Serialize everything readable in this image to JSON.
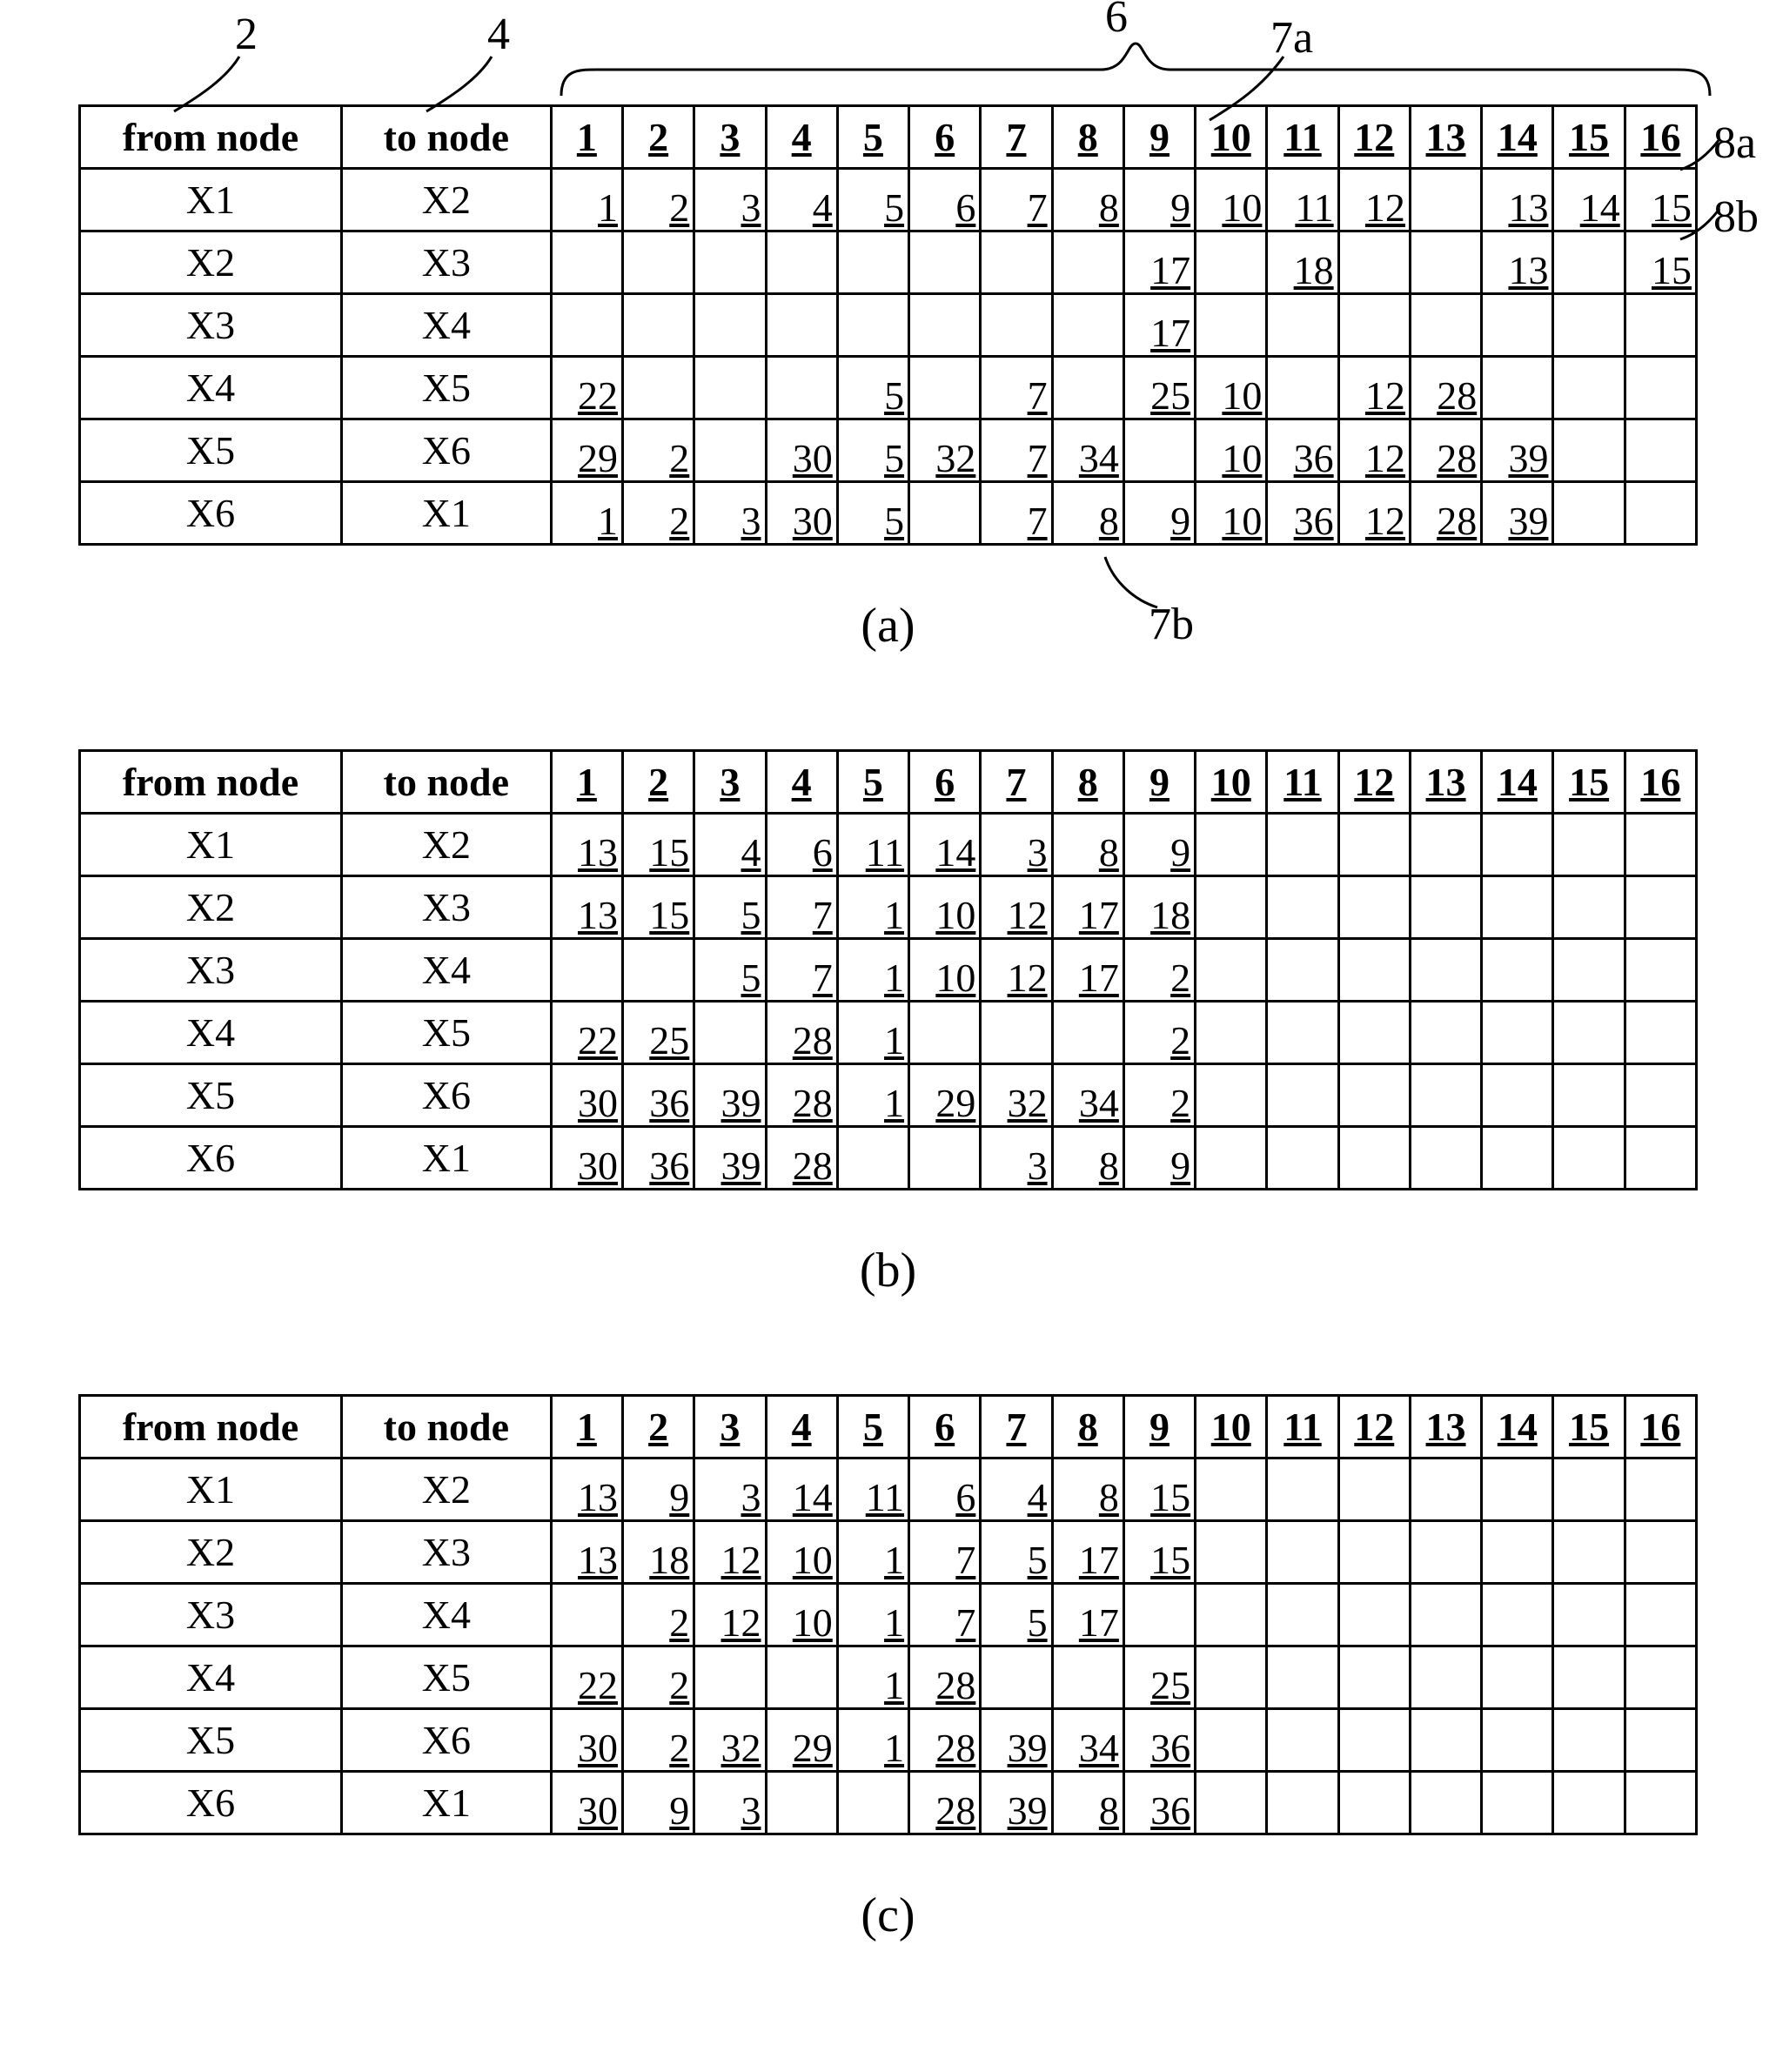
{
  "columns_header": {
    "from": "from node",
    "to": "to node"
  },
  "slot_headers": [
    "1",
    "2",
    "3",
    "4",
    "5",
    "6",
    "7",
    "8",
    "9",
    "10",
    "11",
    "12",
    "13",
    "14",
    "15",
    "16"
  ],
  "annotations": {
    "col_from": "2",
    "col_to": "4",
    "brace_slots": "6",
    "label_7a": "7a",
    "label_7b": "7b",
    "label_8a": "8a",
    "label_8b": "8b"
  },
  "tables": [
    {
      "caption": "(a)",
      "rows": [
        {
          "from": "X1",
          "to": "X2",
          "cells": [
            "1",
            "2",
            "3",
            "4",
            "5",
            "6",
            "7",
            "8",
            "9",
            "10",
            "11",
            "12",
            "",
            "13",
            "14",
            "15"
          ]
        },
        {
          "from": "X2",
          "to": "X3",
          "cells": [
            "",
            "",
            "",
            "",
            "",
            "",
            "",
            "",
            "17",
            "",
            "18",
            "",
            "",
            "13",
            "",
            "15"
          ]
        },
        {
          "from": "X3",
          "to": "X4",
          "cells": [
            "",
            "",
            "",
            "",
            "",
            "",
            "",
            "",
            "17",
            "",
            "",
            "",
            "",
            "",
            "",
            ""
          ]
        },
        {
          "from": "X4",
          "to": "X5",
          "cells": [
            "22",
            "",
            "",
            "",
            "5",
            "",
            "7",
            "",
            "25",
            "10",
            "",
            "12",
            "28",
            "",
            "",
            ""
          ]
        },
        {
          "from": "X5",
          "to": "X6",
          "cells": [
            "29",
            "2",
            "",
            "30",
            "5",
            "32",
            "7",
            "34",
            "",
            "10",
            "36",
            "12",
            "28",
            "39",
            "",
            ""
          ]
        },
        {
          "from": "X6",
          "to": "X1",
          "cells": [
            "1",
            "2",
            "3",
            "30",
            "5",
            "",
            "7",
            "8",
            "9",
            "10",
            "36",
            "12",
            "28",
            "39",
            "",
            ""
          ]
        }
      ]
    },
    {
      "caption": "(b)",
      "rows": [
        {
          "from": "X1",
          "to": "X2",
          "cells": [
            "13",
            "15",
            "4",
            "6",
            "11",
            "14",
            "3",
            "8",
            "9",
            "",
            "",
            "",
            "",
            "",
            "",
            ""
          ]
        },
        {
          "from": "X2",
          "to": "X3",
          "cells": [
            "13",
            "15",
            "5",
            "7",
            "1",
            "10",
            "12",
            "17",
            "18",
            "",
            "",
            "",
            "",
            "",
            "",
            ""
          ]
        },
        {
          "from": "X3",
          "to": "X4",
          "cells": [
            "",
            "",
            "5",
            "7",
            "1",
            "10",
            "12",
            "17",
            "2",
            "",
            "",
            "",
            "",
            "",
            "",
            ""
          ]
        },
        {
          "from": "X4",
          "to": "X5",
          "cells": [
            "22",
            "25",
            "",
            "28",
            "1",
            "",
            "",
            "",
            "2",
            "",
            "",
            "",
            "",
            "",
            "",
            ""
          ]
        },
        {
          "from": "X5",
          "to": "X6",
          "cells": [
            "30",
            "36",
            "39",
            "28",
            "1",
            "29",
            "32",
            "34",
            "2",
            "",
            "",
            "",
            "",
            "",
            "",
            ""
          ]
        },
        {
          "from": "X6",
          "to": "X1",
          "cells": [
            "30",
            "36",
            "39",
            "28",
            "",
            "",
            "3",
            "8",
            "9",
            "",
            "",
            "",
            "",
            "",
            "",
            ""
          ]
        }
      ]
    },
    {
      "caption": "(c)",
      "rows": [
        {
          "from": "X1",
          "to": "X2",
          "cells": [
            "13",
            "9",
            "3",
            "14",
            "11",
            "6",
            "4",
            "8",
            "15",
            "",
            "",
            "",
            "",
            "",
            "",
            ""
          ]
        },
        {
          "from": "X2",
          "to": "X3",
          "cells": [
            "13",
            "18",
            "12",
            "10",
            "1",
            "7",
            "5",
            "17",
            "15",
            "",
            "",
            "",
            "",
            "",
            "",
            ""
          ]
        },
        {
          "from": "X3",
          "to": "X4",
          "cells": [
            "",
            "2",
            "12",
            "10",
            "1",
            "7",
            "5",
            "17",
            "",
            "",
            "",
            "",
            "",
            "",
            "",
            ""
          ]
        },
        {
          "from": "X4",
          "to": "X5",
          "cells": [
            "22",
            "2",
            "",
            "",
            "1",
            "28",
            "",
            "",
            "25",
            "",
            "",
            "",
            "",
            "",
            "",
            ""
          ]
        },
        {
          "from": "X5",
          "to": "X6",
          "cells": [
            "30",
            "2",
            "32",
            "29",
            "1",
            "28",
            "39",
            "34",
            "36",
            "",
            "",
            "",
            "",
            "",
            "",
            ""
          ]
        },
        {
          "from": "X6",
          "to": "X1",
          "cells": [
            "30",
            "9",
            "3",
            "",
            "",
            "28",
            "39",
            "8",
            "36",
            "",
            "",
            "",
            "",
            "",
            "",
            ""
          ]
        }
      ]
    }
  ],
  "chart_data": [
    {
      "type": "table",
      "title": "(a)",
      "columns": [
        "from node",
        "to node",
        "1",
        "2",
        "3",
        "4",
        "5",
        "6",
        "7",
        "8",
        "9",
        "10",
        "11",
        "12",
        "13",
        "14",
        "15",
        "16"
      ],
      "rows": [
        [
          "X1",
          "X2",
          1,
          2,
          3,
          4,
          5,
          6,
          7,
          8,
          9,
          10,
          11,
          12,
          null,
          13,
          14,
          15
        ],
        [
          "X2",
          "X3",
          null,
          null,
          null,
          null,
          null,
          null,
          null,
          null,
          17,
          null,
          18,
          null,
          null,
          13,
          null,
          15
        ],
        [
          "X3",
          "X4",
          null,
          null,
          null,
          null,
          null,
          null,
          null,
          null,
          17,
          null,
          null,
          null,
          null,
          null,
          null,
          null
        ],
        [
          "X4",
          "X5",
          22,
          null,
          null,
          null,
          5,
          null,
          7,
          null,
          25,
          10,
          null,
          12,
          28,
          null,
          null,
          null
        ],
        [
          "X5",
          "X6",
          29,
          2,
          null,
          30,
          5,
          32,
          7,
          34,
          null,
          10,
          36,
          12,
          28,
          39,
          null,
          null
        ],
        [
          "X6",
          "X1",
          1,
          2,
          3,
          30,
          5,
          null,
          7,
          8,
          9,
          10,
          36,
          12,
          28,
          39,
          null,
          null
        ]
      ]
    },
    {
      "type": "table",
      "title": "(b)",
      "columns": [
        "from node",
        "to node",
        "1",
        "2",
        "3",
        "4",
        "5",
        "6",
        "7",
        "8",
        "9",
        "10",
        "11",
        "12",
        "13",
        "14",
        "15",
        "16"
      ],
      "rows": [
        [
          "X1",
          "X2",
          13,
          15,
          4,
          6,
          11,
          14,
          3,
          8,
          9,
          null,
          null,
          null,
          null,
          null,
          null,
          null
        ],
        [
          "X2",
          "X3",
          13,
          15,
          5,
          7,
          1,
          10,
          12,
          17,
          18,
          null,
          null,
          null,
          null,
          null,
          null,
          null
        ],
        [
          "X3",
          "X4",
          null,
          null,
          5,
          7,
          1,
          10,
          12,
          17,
          2,
          null,
          null,
          null,
          null,
          null,
          null,
          null
        ],
        [
          "X4",
          "X5",
          22,
          25,
          null,
          28,
          1,
          null,
          null,
          null,
          2,
          null,
          null,
          null,
          null,
          null,
          null,
          null
        ],
        [
          "X5",
          "X6",
          30,
          36,
          39,
          28,
          1,
          29,
          32,
          34,
          2,
          null,
          null,
          null,
          null,
          null,
          null,
          null
        ],
        [
          "X6",
          "X1",
          30,
          36,
          39,
          28,
          null,
          null,
          3,
          8,
          9,
          null,
          null,
          null,
          null,
          null,
          null,
          null
        ]
      ]
    },
    {
      "type": "table",
      "title": "(c)",
      "columns": [
        "from node",
        "to node",
        "1",
        "2",
        "3",
        "4",
        "5",
        "6",
        "7",
        "8",
        "9",
        "10",
        "11",
        "12",
        "13",
        "14",
        "15",
        "16"
      ],
      "rows": [
        [
          "X1",
          "X2",
          13,
          9,
          3,
          14,
          11,
          6,
          4,
          8,
          15,
          null,
          null,
          null,
          null,
          null,
          null,
          null
        ],
        [
          "X2",
          "X3",
          13,
          18,
          12,
          10,
          1,
          7,
          5,
          17,
          15,
          null,
          null,
          null,
          null,
          null,
          null,
          null
        ],
        [
          "X3",
          "X4",
          null,
          2,
          12,
          10,
          1,
          7,
          5,
          17,
          null,
          null,
          null,
          null,
          null,
          null,
          null,
          null
        ],
        [
          "X4",
          "X5",
          22,
          2,
          null,
          null,
          1,
          28,
          null,
          null,
          25,
          null,
          null,
          null,
          null,
          null,
          null,
          null
        ],
        [
          "X5",
          "X6",
          30,
          2,
          32,
          29,
          1,
          28,
          39,
          34,
          36,
          null,
          null,
          null,
          null,
          null,
          null,
          null
        ],
        [
          "X6",
          "X1",
          30,
          9,
          3,
          null,
          null,
          28,
          39,
          8,
          36,
          null,
          null,
          null,
          null,
          null,
          null,
          null
        ]
      ]
    }
  ]
}
